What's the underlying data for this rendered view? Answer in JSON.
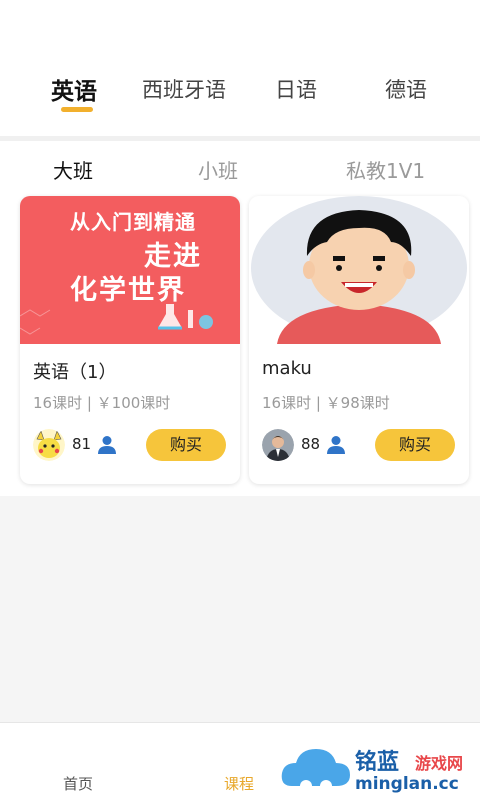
{
  "language_tabs": [
    {
      "label": "英语",
      "active": true
    },
    {
      "label": "西班牙语",
      "active": false
    },
    {
      "label": "日语",
      "active": false
    },
    {
      "label": "德语",
      "active": false
    }
  ],
  "class_tabs": [
    {
      "label": "大班",
      "active": true
    },
    {
      "label": "小班",
      "active": false
    },
    {
      "label": "私教1V1",
      "active": false
    }
  ],
  "courses": [
    {
      "banner_line1": "从入门到精通",
      "banner_line2": "走进",
      "banner_line3": "化学世界",
      "title": "英语（1）",
      "meta": "16课时 | ￥100课时",
      "count": "81",
      "buy_label": "购买"
    },
    {
      "title": "maku",
      "meta": "16课时 | ￥98课时",
      "count": "88",
      "buy_label": "购买"
    }
  ],
  "bottom_nav": [
    {
      "label": "首页",
      "active": false
    },
    {
      "label": "课程",
      "active": true
    }
  ],
  "watermark": {
    "brand": "铭蓝",
    "tag": "游戏网",
    "domain": "minglan.cc"
  },
  "colors": {
    "accent": "#f2b02d",
    "buy_button": "#f6c53b",
    "banner_bg": "#f35d5f"
  }
}
